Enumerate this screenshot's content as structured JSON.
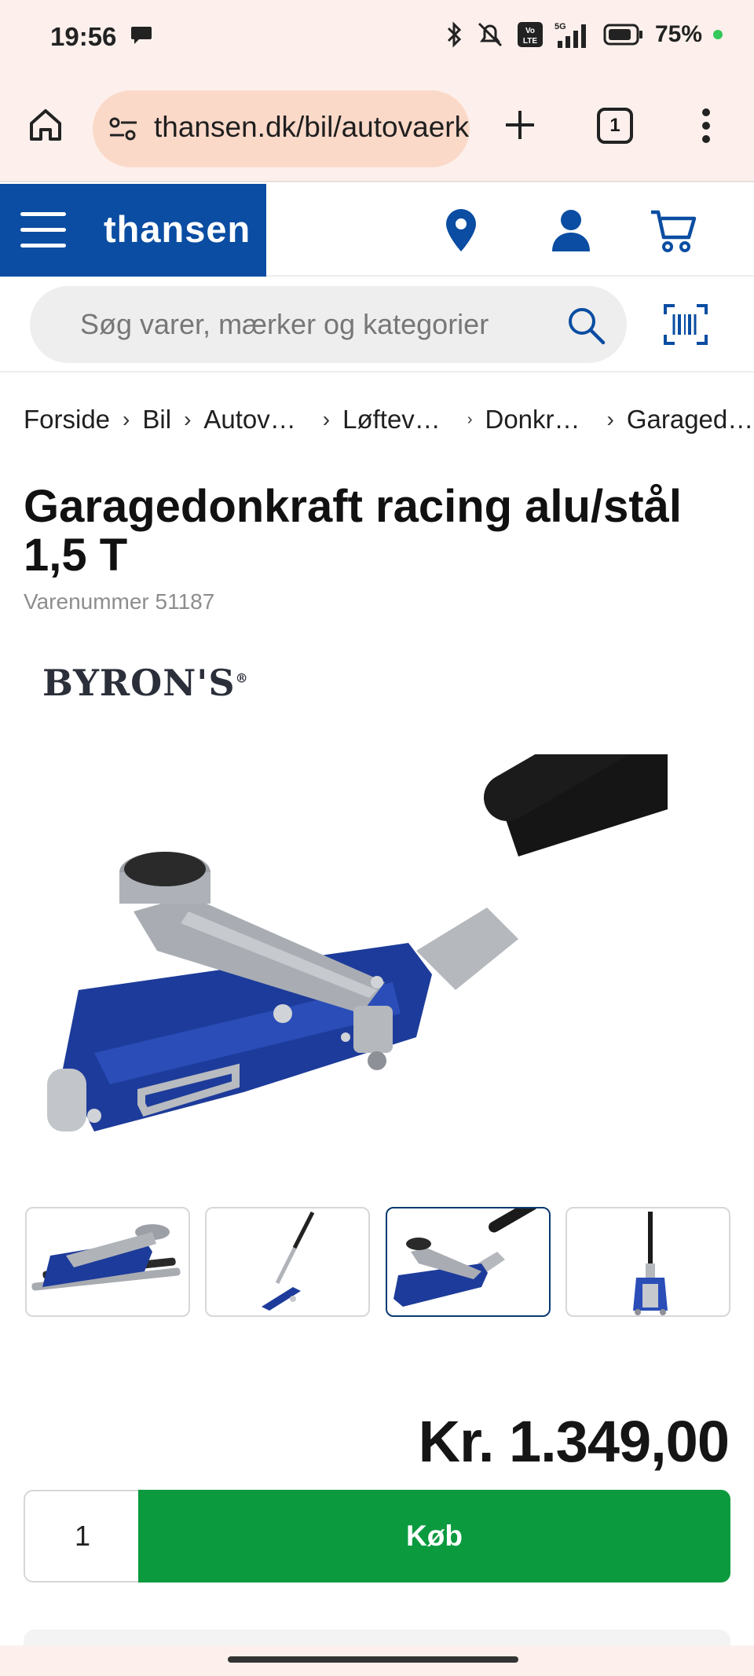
{
  "status_bar": {
    "time": "19:56",
    "battery": "75%",
    "network": "5G"
  },
  "browser": {
    "url": "thansen.dk/bil/autovaerktoej",
    "tab_count": "1"
  },
  "site": {
    "brand": "thansen",
    "brand_color": "#0a4da2"
  },
  "search": {
    "placeholder": "Søg varer, mærker og kategorier"
  },
  "breadcrumb": [
    "Forside",
    "Bil",
    "Autov…",
    "Løftev…",
    "Donkr…",
    "Garaged…"
  ],
  "product": {
    "title": "Garagedonkraft racing alu/stål 1,5 T",
    "sku": "Varenummer 51187",
    "brand_mark": "BYRON'S",
    "price": "Kr. 1.349,00",
    "quantity": "1",
    "buy_label": "Køb",
    "buy_color": "#0b9a3e"
  },
  "thumbnails": [
    {
      "name": "thumb-jack-with-handle-parts"
    },
    {
      "name": "thumb-jack-side-upright-handle"
    },
    {
      "name": "thumb-jack-angled",
      "active": true
    },
    {
      "name": "thumb-jack-back-view"
    }
  ]
}
